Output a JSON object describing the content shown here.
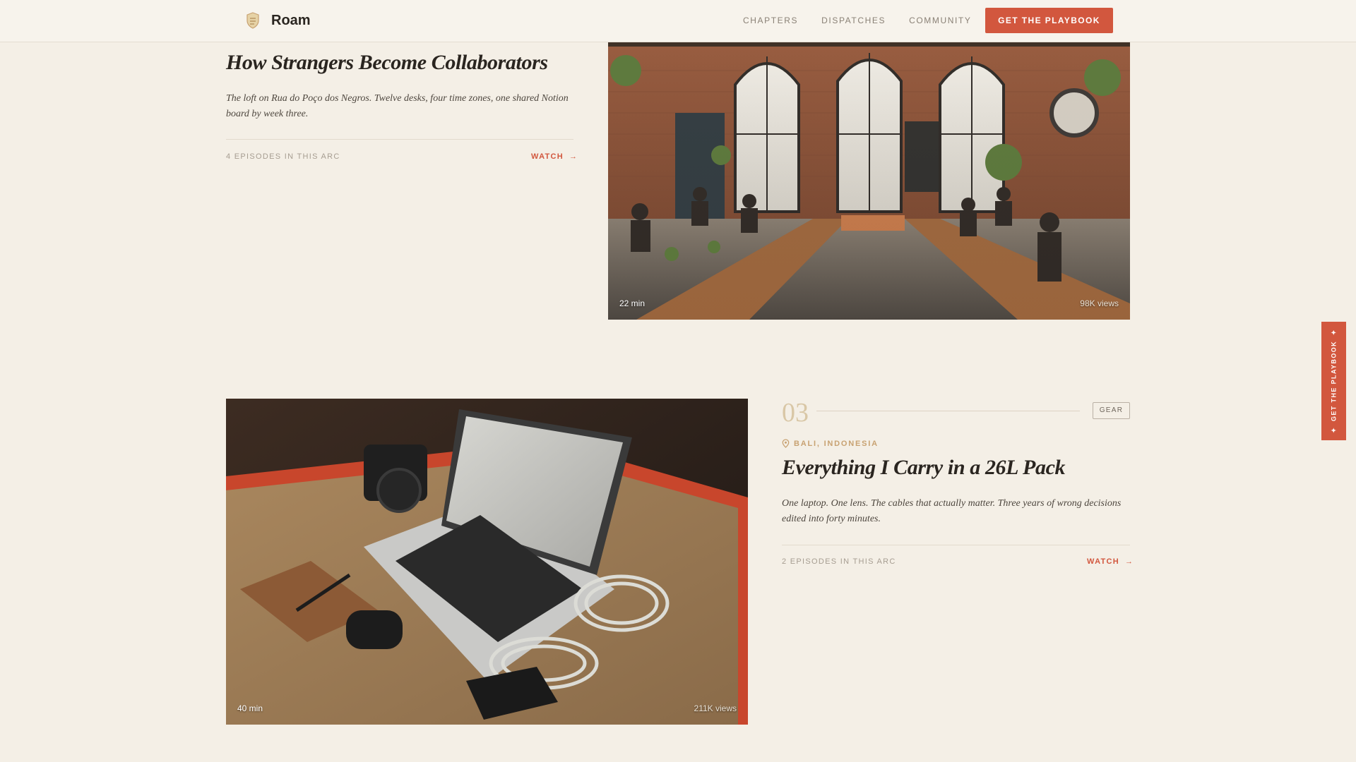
{
  "header": {
    "brand": "Roam",
    "nav": [
      "CHAPTERS",
      "DISPATCHES",
      "COMMUNITY"
    ],
    "cta": "GET THE PLAYBOOK"
  },
  "stories": [
    {
      "title": "How Strangers Become Collaborators",
      "description": "The loft on Rua do Poço dos Negros. Twelve desks, four time zones, one shared Notion board by week three.",
      "arc_count": "4 EPISODES IN THIS ARC",
      "watch": "WATCH",
      "duration": "22 min",
      "views": "98K views"
    },
    {
      "number": "03",
      "tag": "GEAR",
      "location": "BALI, INDONESIA",
      "title": "Everything I Carry in a 26L Pack",
      "description": "One laptop. One lens. The cables that actually matter. Three years of wrong decisions edited into forty minutes.",
      "arc_count": "2 EPISODES IN THIS ARC",
      "watch": "WATCH",
      "duration": "40 min",
      "views": "211K views"
    }
  ],
  "side_tab": "GET THE PLAYBOOK",
  "colors": {
    "background": "#f4efe6",
    "accent": "#d2573e",
    "location": "#c8a272",
    "chapter_number": "#d9c7a6"
  },
  "icons": {
    "brand": "roam-logo-icon",
    "location": "map-pin-icon",
    "watch": "arrow-right-icon"
  }
}
